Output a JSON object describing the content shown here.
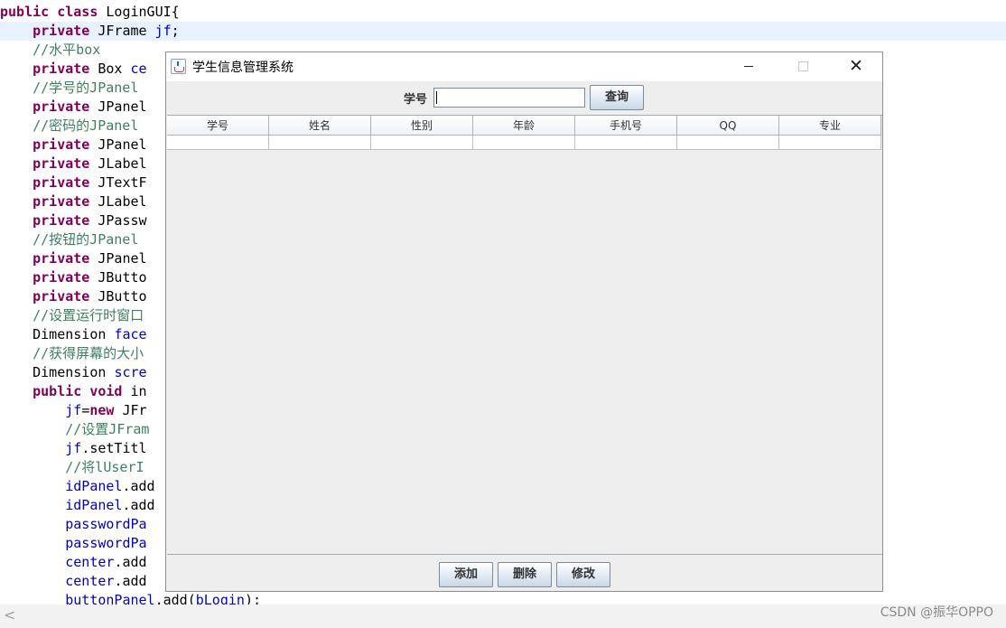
{
  "editor": {
    "lines": [
      [
        {
          "t": "public class",
          "c": "kw"
        },
        {
          "t": " LoginGUI{",
          "c": ""
        }
      ],
      [
        {
          "t": "    ",
          "c": ""
        },
        {
          "t": "private",
          "c": "kw"
        },
        {
          "t": " JFrame ",
          "c": ""
        },
        {
          "t": "jf",
          "c": "fd"
        },
        {
          "t": ";",
          "c": ""
        }
      ],
      [
        {
          "t": "    //水平box",
          "c": "cm"
        }
      ],
      [
        {
          "t": "    ",
          "c": ""
        },
        {
          "t": "private",
          "c": "kw"
        },
        {
          "t": " Box ",
          "c": ""
        },
        {
          "t": "ce",
          "c": "fd"
        }
      ],
      [
        {
          "t": "    //学号的JPanel",
          "c": "cm"
        }
      ],
      [
        {
          "t": "    ",
          "c": ""
        },
        {
          "t": "private",
          "c": "kw"
        },
        {
          "t": " JPanel",
          "c": ""
        }
      ],
      [
        {
          "t": "    //密码的JPanel",
          "c": "cm"
        }
      ],
      [
        {
          "t": "    ",
          "c": ""
        },
        {
          "t": "private",
          "c": "kw"
        },
        {
          "t": " JPanel",
          "c": ""
        }
      ],
      [
        {
          "t": "    ",
          "c": ""
        },
        {
          "t": "private",
          "c": "kw"
        },
        {
          "t": " JLabel",
          "c": ""
        }
      ],
      [
        {
          "t": "    ",
          "c": ""
        },
        {
          "t": "private",
          "c": "kw"
        },
        {
          "t": " JTextF",
          "c": ""
        }
      ],
      [
        {
          "t": "    ",
          "c": ""
        },
        {
          "t": "private",
          "c": "kw"
        },
        {
          "t": " JLabel",
          "c": ""
        }
      ],
      [
        {
          "t": "    ",
          "c": ""
        },
        {
          "t": "private",
          "c": "kw"
        },
        {
          "t": " JPassw",
          "c": ""
        }
      ],
      [
        {
          "t": "    //按钮的JPanel",
          "c": "cm"
        }
      ],
      [
        {
          "t": "    ",
          "c": ""
        },
        {
          "t": "private",
          "c": "kw"
        },
        {
          "t": " JPanel",
          "c": ""
        }
      ],
      [
        {
          "t": "    ",
          "c": ""
        },
        {
          "t": "private",
          "c": "kw"
        },
        {
          "t": " JButto",
          "c": ""
        }
      ],
      [
        {
          "t": "    ",
          "c": ""
        },
        {
          "t": "private",
          "c": "kw"
        },
        {
          "t": " JButto",
          "c": ""
        }
      ],
      [
        {
          "t": "    //设置运行时窗口",
          "c": "cm"
        }
      ],
      [
        {
          "t": "    Dimension ",
          "c": ""
        },
        {
          "t": "face",
          "c": "fd"
        }
      ],
      [
        {
          "t": "    //获得屏幕的大小",
          "c": "cm"
        }
      ],
      [
        {
          "t": "    Dimension ",
          "c": ""
        },
        {
          "t": "scre",
          "c": "fd"
        }
      ],
      [
        {
          "t": "    ",
          "c": ""
        },
        {
          "t": "public void",
          "c": "kw"
        },
        {
          "t": " in",
          "c": ""
        }
      ],
      [
        {
          "t": "        ",
          "c": ""
        },
        {
          "t": "jf",
          "c": "fd"
        },
        {
          "t": "=",
          "c": ""
        },
        {
          "t": "new",
          "c": "kw"
        },
        {
          "t": " JFr",
          "c": ""
        }
      ],
      [
        {
          "t": "        //设置JFram",
          "c": "cm"
        }
      ],
      [
        {
          "t": "        ",
          "c": ""
        },
        {
          "t": "jf",
          "c": "fd"
        },
        {
          "t": ".setTitl",
          "c": ""
        }
      ],
      [
        {
          "t": "        //将lUserI",
          "c": "cm"
        }
      ],
      [
        {
          "t": "        ",
          "c": ""
        },
        {
          "t": "idPanel",
          "c": "fd"
        },
        {
          "t": ".add",
          "c": ""
        }
      ],
      [
        {
          "t": "        ",
          "c": ""
        },
        {
          "t": "idPanel",
          "c": "fd"
        },
        {
          "t": ".add",
          "c": ""
        }
      ],
      [
        {
          "t": "        ",
          "c": ""
        },
        {
          "t": "passwordPa",
          "c": "fd"
        }
      ],
      [
        {
          "t": "        ",
          "c": ""
        },
        {
          "t": "passwordPa",
          "c": "fd"
        }
      ],
      [
        {
          "t": "        ",
          "c": ""
        },
        {
          "t": "center",
          "c": "fd"
        },
        {
          "t": ".add",
          "c": ""
        }
      ],
      [
        {
          "t": "        ",
          "c": ""
        },
        {
          "t": "center",
          "c": "fd"
        },
        {
          "t": ".add",
          "c": ""
        }
      ],
      [
        {
          "t": "        ",
          "c": ""
        },
        {
          "t": "buttonPanel",
          "c": "fd"
        },
        {
          "t": ".add(",
          "c": ""
        },
        {
          "t": "bLogin",
          "c": "fd"
        },
        {
          "t": ");",
          "c": ""
        }
      ]
    ],
    "highlight_line": 1
  },
  "window": {
    "title": "学生信息管理系统",
    "search_label": "学号",
    "search_value": "",
    "search_button": "查询",
    "columns": [
      "学号",
      "姓名",
      "性别",
      "年龄",
      "手机号",
      "QQ",
      "专业"
    ],
    "add_button": "添加",
    "delete_button": "删除",
    "edit_button": "修改"
  },
  "scroll_left_arrow": "<",
  "watermark": "CSDN @振华OPPO"
}
